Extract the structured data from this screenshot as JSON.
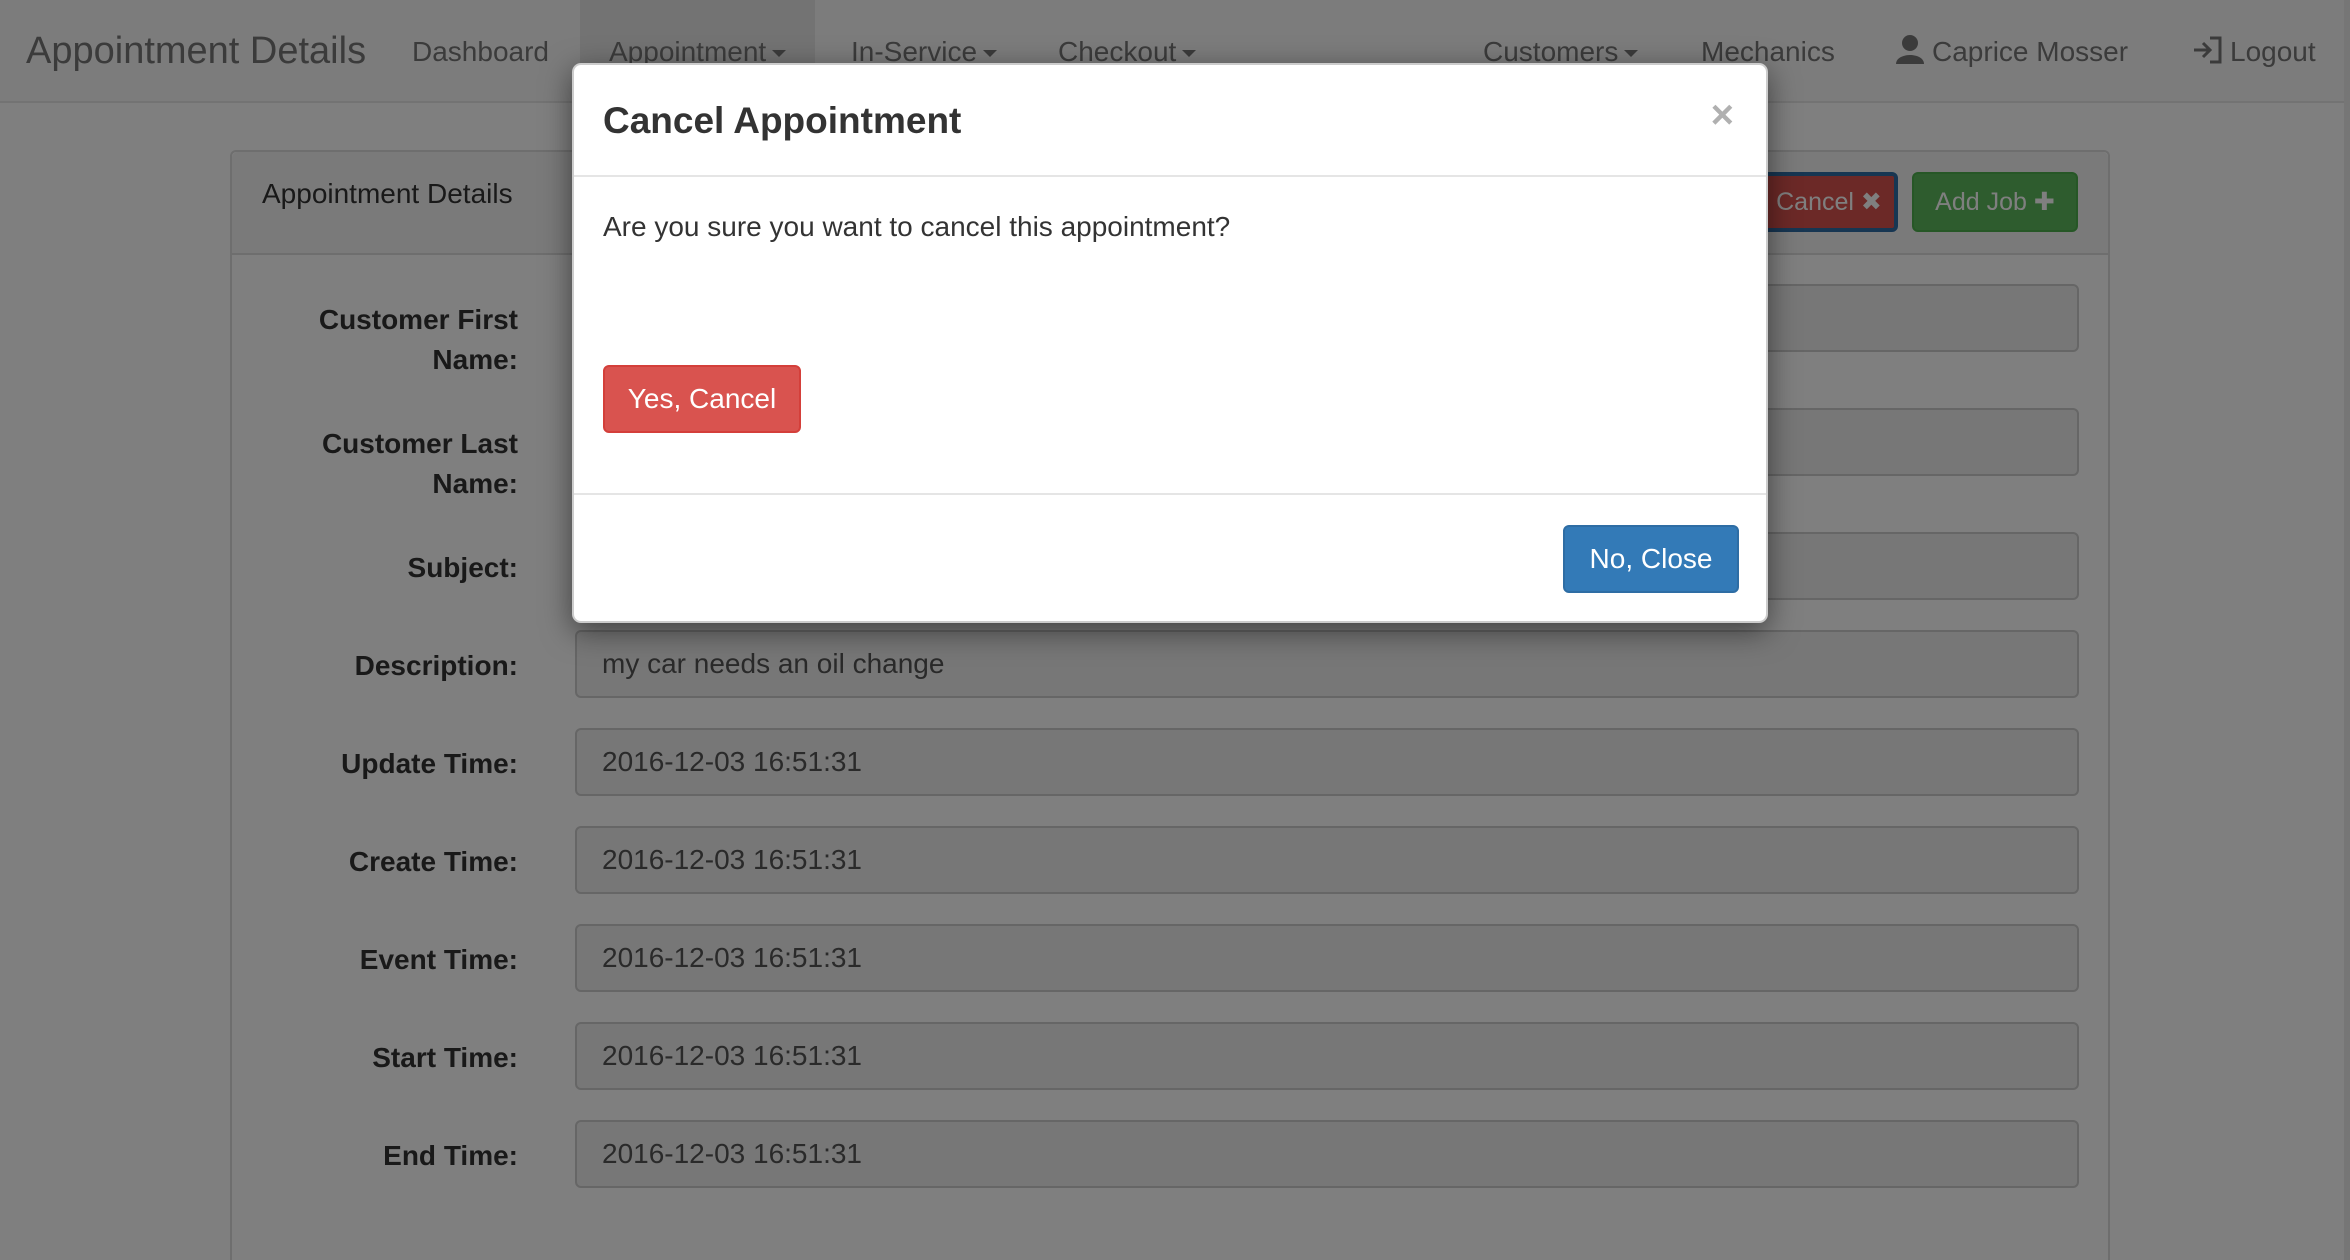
{
  "navbar": {
    "brand": "Appointment Details",
    "items": [
      {
        "label": "Dashboard"
      },
      {
        "label": "Appointment"
      },
      {
        "label": "In-Service"
      },
      {
        "label": "Checkout"
      },
      {
        "label": "Customers"
      },
      {
        "label": "Mechanics"
      }
    ],
    "user": "Caprice Mosser",
    "logout": "Logout"
  },
  "panel": {
    "title": "Appointment Details",
    "cancel_label": "Cancel",
    "add_job_label": "Add Job",
    "fields": [
      {
        "label": "Customer First Name:",
        "value": ""
      },
      {
        "label": "Customer Last Name:",
        "value": ""
      },
      {
        "label": "Subject:",
        "value": ""
      },
      {
        "label": "Description:",
        "value": "my car needs an oil change"
      },
      {
        "label": "Update Time:",
        "value": "2016-12-03 16:51:31"
      },
      {
        "label": "Create Time:",
        "value": "2016-12-03 16:51:31"
      },
      {
        "label": "Event Time:",
        "value": "2016-12-03 16:51:31"
      },
      {
        "label": "Start Time:",
        "value": "2016-12-03 16:51:31"
      },
      {
        "label": "End Time:",
        "value": "2016-12-03 16:51:31"
      }
    ]
  },
  "modal": {
    "title": "Cancel Appointment",
    "close_glyph": "×",
    "message": "Are you sure you want to cancel this appointment?",
    "confirm_label": "Yes, Cancel",
    "dismiss_label": "No, Close"
  },
  "colors": {
    "danger": "#d9534f",
    "success": "#5cb85c",
    "primary": "#337ab7"
  }
}
